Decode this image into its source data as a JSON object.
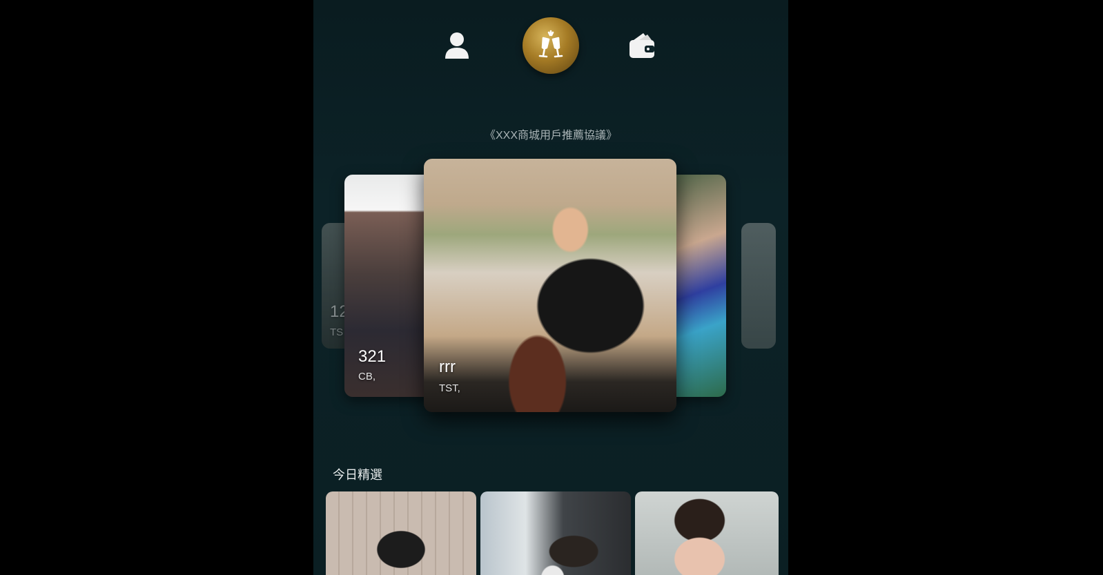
{
  "nav": {
    "items": [
      {
        "icon": "user-icon"
      },
      {
        "icon": "cheers-icon",
        "active": true,
        "accent": "#b78a30"
      },
      {
        "icon": "wallet-icon"
      }
    ]
  },
  "agreement_link": "《XXX商城用戶推薦協議》",
  "carousel": {
    "cards": [
      {
        "position": "far-left",
        "name": "12",
        "location": "TS"
      },
      {
        "position": "left",
        "name": "321",
        "location": "CB,"
      },
      {
        "position": "center",
        "name": "rrr",
        "location": "TST,"
      },
      {
        "position": "right",
        "name": "",
        "location": ""
      },
      {
        "position": "far-right",
        "name": "",
        "location": ""
      }
    ]
  },
  "featured": {
    "title": "今日精選",
    "thumbnails": [
      {
        "name": "featured-photo-1"
      },
      {
        "name": "featured-photo-2"
      },
      {
        "name": "featured-photo-3"
      }
    ]
  },
  "colors": {
    "background": "#0c2227",
    "gold_accent": "#b78a30",
    "text_muted": "#aab4b6"
  }
}
